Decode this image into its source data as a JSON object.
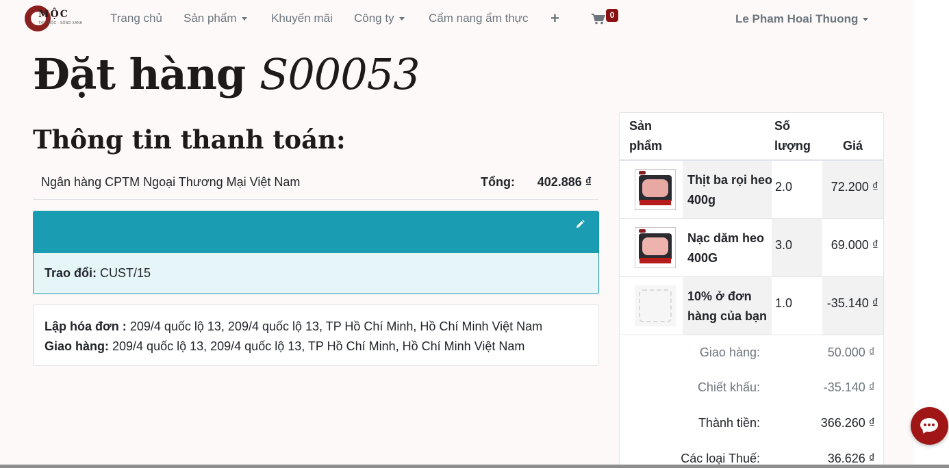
{
  "brand": {
    "name": "MỘC",
    "tagline": "THỊT MỘC - SỐNG XANH"
  },
  "nav": {
    "home": "Trang chủ",
    "products": "Sản phẩm",
    "promotions": "Khuyến mãi",
    "company": "Công ty",
    "cooking_guide": "Cẩm nang ẩm thực",
    "cart_count": "0",
    "user": "Le Pham Hoai Thuong"
  },
  "order": {
    "title_prefix": "Đặt hàng ",
    "number": "S00053",
    "payment_heading": "Thông tin thanh toán:"
  },
  "payment": {
    "bank": "Ngân hàng CPTM Ngoại Thương Mại Việt Nam",
    "total_label": "Tổng:",
    "total_value": "402.886 ₫"
  },
  "exchange": {
    "label": "Trao đổi:",
    "value": "CUST/15"
  },
  "addresses": {
    "invoice_label": "Lập hóa đơn :",
    "invoice_value": "209/4 quốc lộ 13, 209/4 quốc lộ 13, TP Hồ Chí Minh, Hồ Chí Minh Việt Nam",
    "shipping_label": "Giao hàng:",
    "shipping_value": "209/4 quốc lộ 13, 209/4 quốc lộ 13, TP Hồ Chí Minh, Hồ Chí Minh Việt Nam"
  },
  "table": {
    "headers": {
      "product_l1": "Sản",
      "product_l2": "phẩm",
      "qty_l1": "Số",
      "qty_l2": "lượng",
      "price": "Giá"
    },
    "rows": [
      {
        "name": "Thịt ba rọi heo 400g",
        "qty": "2.0",
        "price": "72.200 ₫"
      },
      {
        "name": "Nạc dăm heo 400G",
        "qty": "3.0",
        "price": "69.000 ₫"
      },
      {
        "name": "10% ở đơn hàng của bạn",
        "qty": "1.0",
        "price": "-35.140 ₫"
      }
    ],
    "summary": [
      {
        "label": "Giao hàng:",
        "value": "50.000 ₫"
      },
      {
        "label": "Chiết khấu:",
        "value": "-35.140 ₫"
      },
      {
        "label": "Thành tiền:",
        "value": "366.260 ₫"
      },
      {
        "label": "Các loại Thuế:",
        "value": "36.626 ₫"
      }
    ]
  },
  "colors": {
    "accent": "#1a9cb2",
    "brand": "#8a1111",
    "chat": "#a01515"
  },
  "icons": {
    "cart": "shopping-cart-icon",
    "edit": "pencil-icon",
    "chat": "chat-bubble-icon",
    "add": "plus-icon"
  }
}
